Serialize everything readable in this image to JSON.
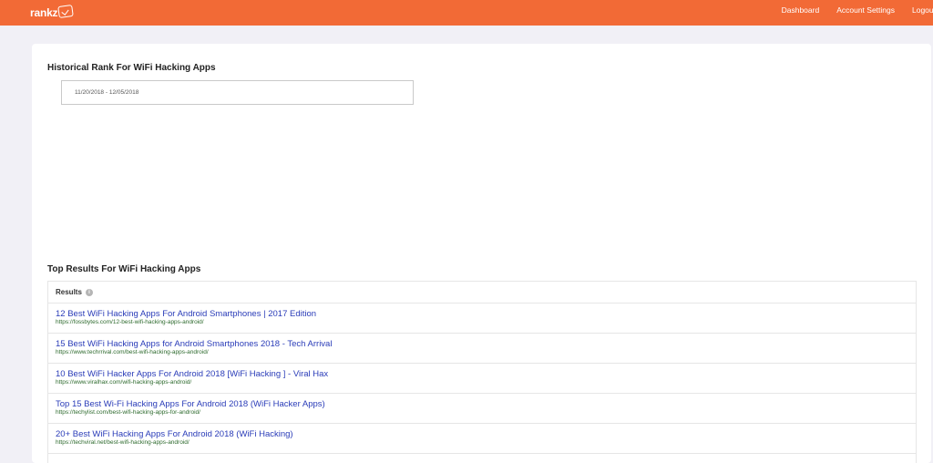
{
  "app": {
    "brand": "rankz"
  },
  "nav": {
    "items": [
      {
        "label": "Dashboard"
      },
      {
        "label": "Account Settings"
      },
      {
        "label": "Logout"
      }
    ]
  },
  "historical": {
    "title": "Historical Rank For WiFi Hacking Apps",
    "date_range": "11/20/2018 - 12/05/2018"
  },
  "top_results": {
    "title": "Top Results For WiFi Hacking Apps",
    "column_header": "Results",
    "info_icon": "info-icon",
    "rows": [
      {
        "title": "12 Best WiFi Hacking Apps For Android Smartphones | 2017 Edition",
        "url": "https://fossbytes.com/12-best-wifi-hacking-apps-android/"
      },
      {
        "title": "15 Best WiFi Hacking Apps for Android Smartphones 2018 - Tech Arrival",
        "url": "https://www.techrrival.com/best-wifi-hacking-apps-android/"
      },
      {
        "title": "10 Best WiFi Hacker Apps For Android 2018 [WiFi Hacking ] - Viral Hax",
        "url": "https://www.viralhax.com/wifi-hacking-apps-android/"
      },
      {
        "title": "Top 15 Best Wi-Fi Hacking Apps For Android 2018 (WiFi Hacker Apps)",
        "url": "https://techylist.com/best-wifi-hacking-apps-for-android/"
      },
      {
        "title": "20+ Best WiFi Hacking Apps For Android 2018 (WiFi Hacking)",
        "url": "https://techviral.net/best-wifi-hacking-apps-android/"
      }
    ]
  },
  "colors": {
    "header": "#f26a36",
    "link": "#2a3cb8",
    "url": "#2d6a2d",
    "background": "#f1f0f6"
  }
}
